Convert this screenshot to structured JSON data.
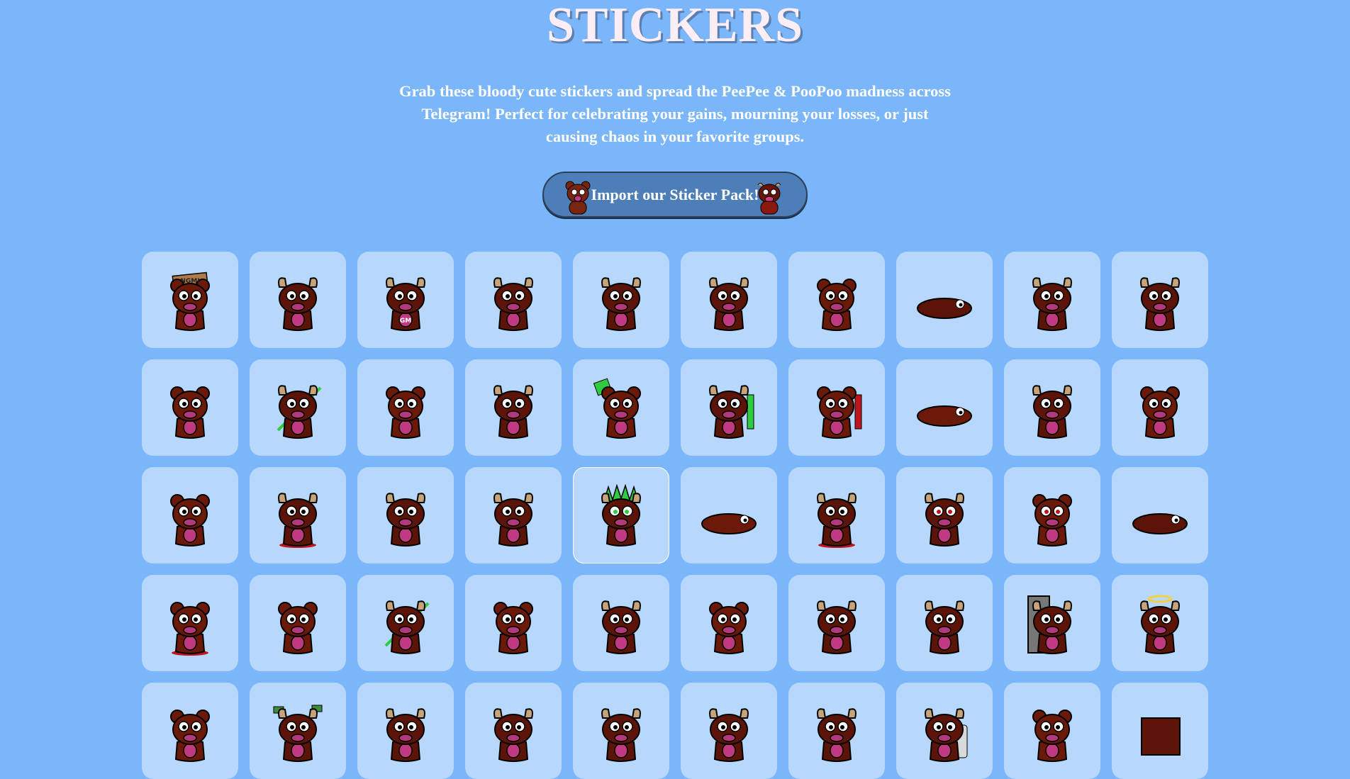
{
  "header": {
    "title": "STICKERS",
    "description": "Grab these bloody cute stickers and spread the PeePee & PooPoo madness across Telegram! Perfect for celebrating your gains, mourning your losses, or just causing chaos in your favorite groups."
  },
  "import_button": {
    "label": "Import our Sticker Pack!"
  },
  "colors": {
    "background": "#7ab6f9",
    "tile": "#b7d8fc",
    "button": "#4d7eb7",
    "bear_body": "#6b1a0a",
    "bull_body": "#5c1408",
    "accent_green": "#2ecc40",
    "accent_red": "#c0141c"
  },
  "stickers": [
    {
      "icon": "bear-ngmi-sign-sticker",
      "kind": "bear",
      "prop": "sign",
      "sign_text": "NGMI"
    },
    {
      "icon": "bull-phone-sticker",
      "kind": "bull",
      "prop": "phone"
    },
    {
      "icon": "bull-gm-sticker",
      "kind": "bull",
      "prop": "gm",
      "sign_text": "GM"
    },
    {
      "icon": "bull-sunglasses-sticker",
      "kind": "bull",
      "prop": "shades"
    },
    {
      "icon": "bull-smoking-sticker",
      "kind": "bull",
      "prop": "smoke"
    },
    {
      "icon": "bull-smug-sticker",
      "kind": "bull",
      "prop": "smug"
    },
    {
      "icon": "hairy-face-sticker",
      "kind": "bear",
      "prop": "hairy"
    },
    {
      "icon": "lying-vape-sticker",
      "kind": "bull",
      "prop": "lying"
    },
    {
      "icon": "bull-knife-sticker",
      "kind": "bull",
      "prop": "knife"
    },
    {
      "icon": "bull-grin-sticker",
      "kind": "bull",
      "prop": "grin"
    },
    {
      "icon": "bear-peek-sticker",
      "kind": "bear",
      "prop": "peek"
    },
    {
      "icon": "bull-shocked-sticker",
      "kind": "bull",
      "prop": "needle"
    },
    {
      "icon": "bear-falling-sticker",
      "kind": "bear",
      "prop": "falling"
    },
    {
      "icon": "bull-ninja-sticker",
      "kind": "bull",
      "prop": "ninja"
    },
    {
      "icon": "bear-flag-sticker",
      "kind": "bear",
      "prop": "flag"
    },
    {
      "icon": "bull-green-candle-sticker",
      "kind": "bull",
      "prop": "green-candle"
    },
    {
      "icon": "bear-red-candle-sticker",
      "kind": "bear",
      "prop": "red-candle"
    },
    {
      "icon": "bear-lying-needle-sticker",
      "kind": "bear",
      "prop": "lying"
    },
    {
      "icon": "bull-hug-sticker",
      "kind": "bull",
      "prop": "hug"
    },
    {
      "icon": "bear-hug-sticker",
      "kind": "bear",
      "prop": "hug"
    },
    {
      "icon": "bear-duo-sticker",
      "kind": "bear",
      "prop": "duo"
    },
    {
      "icon": "bull-bleeding-sticker",
      "kind": "bull",
      "prop": "blood"
    },
    {
      "icon": "bull-angry-sticker",
      "kind": "bull",
      "prop": "angry"
    },
    {
      "icon": "bull-angry-2-sticker",
      "kind": "bull",
      "prop": "angry"
    },
    {
      "icon": "bull-green-crown-sticker",
      "kind": "bull",
      "prop": "green-crown",
      "hover": true
    },
    {
      "icon": "bear-lying-sticker",
      "kind": "bear",
      "prop": "lying"
    },
    {
      "icon": "bull-bloody-duo-sticker",
      "kind": "bull",
      "prop": "blood"
    },
    {
      "icon": "bull-red-eyes-sticker",
      "kind": "bull",
      "prop": "red-eyes"
    },
    {
      "icon": "bear-red-eyes-sticker",
      "kind": "bear",
      "prop": "red-eyes"
    },
    {
      "icon": "bull-lying-blood-sticker",
      "kind": "bull",
      "prop": "lying"
    },
    {
      "icon": "bear-bloody-duo-sticker",
      "kind": "bear",
      "prop": "blood"
    },
    {
      "icon": "bear-army-sticker",
      "kind": "bear",
      "prop": "army"
    },
    {
      "icon": "bull-green-stick-sticker",
      "kind": "bull",
      "prop": "needle"
    },
    {
      "icon": "bear-antenna-sticker",
      "kind": "bear",
      "prop": "antenna"
    },
    {
      "icon": "bull-wave-sticker",
      "kind": "bull",
      "prop": "wave"
    },
    {
      "icon": "bear-back-sticker",
      "kind": "bear",
      "prop": "back"
    },
    {
      "icon": "bull-magnifier-sticker",
      "kind": "bull",
      "prop": "magnifier"
    },
    {
      "icon": "bull-fingers-sticker",
      "kind": "bull",
      "prop": "fingers"
    },
    {
      "icon": "bull-door-sticker",
      "kind": "bull",
      "prop": "door"
    },
    {
      "icon": "bull-halo-sticker",
      "kind": "bull",
      "prop": "halo"
    },
    {
      "icon": "bear-pipe-sticker",
      "kind": "bear",
      "prop": "pipe"
    },
    {
      "icon": "bull-money-sticker",
      "kind": "bull",
      "prop": "money"
    },
    {
      "icon": "bull-coffee-sticker",
      "kind": "bull",
      "prop": "coffee"
    },
    {
      "icon": "bull-laugh-sticker",
      "kind": "bull",
      "prop": "laugh"
    },
    {
      "icon": "bull-tongue-sticker",
      "kind": "bull",
      "prop": "tongue"
    },
    {
      "icon": "bull-facepalm-sticker",
      "kind": "bull",
      "prop": "facepalm"
    },
    {
      "icon": "bull-blank-sticker",
      "kind": "bull",
      "prop": "blank"
    },
    {
      "icon": "bull-bottle-sticker",
      "kind": "bull",
      "prop": "bottle"
    },
    {
      "icon": "bear-gun-sticker",
      "kind": "bear",
      "prop": "gun"
    },
    {
      "icon": "bull-box-sticker",
      "kind": "bull",
      "prop": "box"
    }
  ]
}
